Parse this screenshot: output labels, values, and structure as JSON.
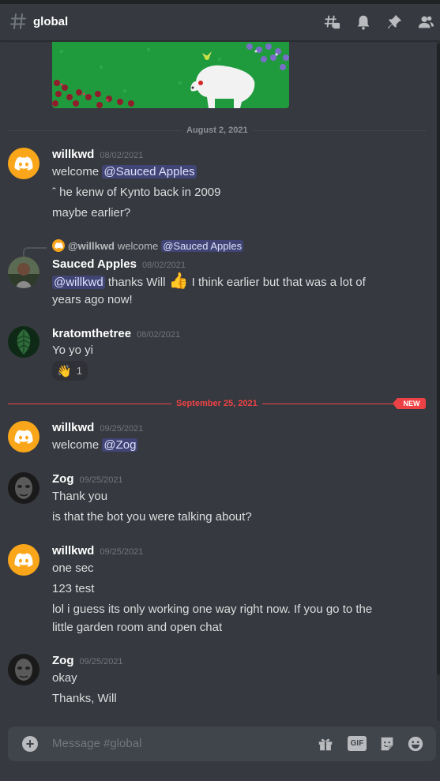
{
  "channel": {
    "name": "global"
  },
  "header_icons": [
    "threads-icon",
    "bell-icon",
    "pin-icon",
    "members-icon"
  ],
  "dividers": [
    {
      "label": "August 2, 2021",
      "highlight": false
    },
    {
      "label": "September 25, 2021",
      "highlight": true,
      "badge": "NEW"
    }
  ],
  "messages": [
    {
      "author": "willkwd",
      "time": "08/02/2021",
      "lines": [
        {
          "text": "welcome ",
          "mention": "@Sauced Apples"
        },
        {
          "text": "ˆ he kenw of Kynto  back in 2009"
        },
        {
          "text": "maybe earlier?"
        }
      ]
    },
    {
      "reply": {
        "author": "@willkwd",
        "text": "welcome",
        "mention": "@Sauced Apples"
      },
      "author": "Sauced Apples",
      "time": "08/02/2021",
      "lines": [
        {
          "mention": "@willkwd",
          "text": " thanks Will",
          "emoji": "👍",
          "text2": " I think earlier but that was a lot of"
        },
        {
          "text": "years ago now!"
        }
      ]
    },
    {
      "author": "kratomthetree",
      "time": "08/02/2021",
      "lines": [
        {
          "text": "Yo yo yi"
        }
      ],
      "reaction": {
        "emoji": "👋",
        "count": "1"
      }
    },
    {
      "author": "willkwd",
      "time": "09/25/2021",
      "lines": [
        {
          "text": "welcome ",
          "mention": "@Zog"
        }
      ]
    },
    {
      "author": "Zog",
      "time": "09/25/2021",
      "lines": [
        {
          "text": "Thank you"
        },
        {
          "text": "is that the bot you were talking about?"
        }
      ]
    },
    {
      "author": "willkwd",
      "time": "09/25/2021",
      "lines": [
        {
          "text": "one sec"
        },
        {
          "text": "123 test"
        },
        {
          "text": "lol i guess its only working one way right now. If you go to the"
        },
        {
          "text": "little garden room and open chat"
        }
      ]
    },
    {
      "author": "Zog",
      "time": "09/25/2021",
      "lines": [
        {
          "text": "okay"
        },
        {
          "text": "Thanks, Will"
        }
      ]
    }
  ],
  "composer": {
    "placeholder": "Message #global",
    "gif_label": "GIF",
    "icons": [
      "add-attachment-icon",
      "gift-icon",
      "gif-icon",
      "sticker-icon",
      "emoji-icon"
    ]
  },
  "colors": {
    "accent": "#5865f2",
    "new": "#ed4245",
    "bot_avatar": "#faa61a"
  }
}
